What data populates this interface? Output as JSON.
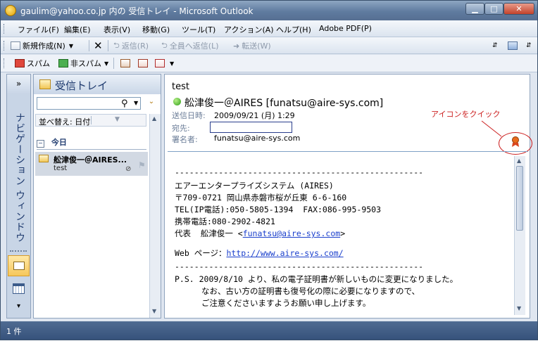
{
  "window": {
    "title": "gaulim@yahoo.co.jp 内の 受信トレイ - Microsoft Outlook"
  },
  "menu": [
    "ファイル(F)",
    "編集(E)",
    "表示(V)",
    "移動(G)",
    "ツール(T)",
    "アクション(A)",
    "ヘルプ(H)",
    "Adobe PDF(P)"
  ],
  "toolbar": {
    "new": "新規作成(N)",
    "reply": "返信(R)",
    "reply_all": "全員へ返信(L)",
    "forward": "転送(W)"
  },
  "spam_bar": {
    "spam": "スパム",
    "not_spam": "非スパム"
  },
  "nav": {
    "label": "ナビゲーション ウィンドウ",
    "expand": "»"
  },
  "list": {
    "title": "受信トレイ",
    "search_value": "",
    "sort_label": "並べ替え: 日付",
    "group_label": "今日",
    "message": {
      "sender": "舩津俊一＠AIRES...",
      "subject": "test"
    }
  },
  "reading": {
    "subject": "test",
    "from": "舩津俊一＠AIRES [funatsu@aire-sys.com]",
    "sent_label": "送信日時:",
    "sent_value": "2009/09/21 (月) 1:29",
    "to_label": "宛先:",
    "signed_label": "署名者:",
    "signed_value": "funatsu@aire-sys.com",
    "annotation": "アイコンをクイック",
    "body": [
      "---------------------------------------------------",
      "エアーエンタープライズシステム (AIRES)",
      "〒709-0721 岡山県赤磐市桜が丘東 6-6-160",
      "TEL(IP電話):050-5805-1394  FAX:086-995-9503",
      "携帯電話:080-2902-4821",
      "代表  舩津俊一 <",
      "funatsu@aire-sys.com",
      ">",
      "Web ページ：",
      "http://www.aire-sys.com/",
      "---------------------------------------------------",
      "P.S. 2009/8/10 より、私の電子証明書が新しいものに変更になりました。",
      "なお、古い方の証明書も復号化の際に必要になりますので、",
      "ご注意くださいますようお願い申し上げます。"
    ]
  },
  "status": {
    "count": "1 件"
  },
  "colors": {
    "annotation": "#cc2020",
    "link": "#1a3fcc",
    "statusbar": "#3f5e88"
  }
}
